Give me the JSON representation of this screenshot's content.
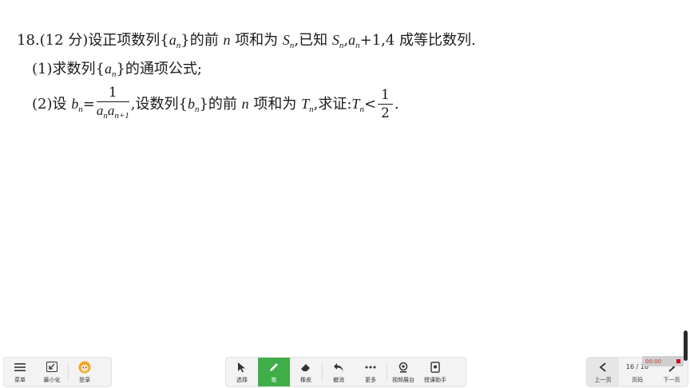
{
  "problem": {
    "intro": {
      "number": "18.",
      "score": "(12 分)",
      "text1": "设正项数列{",
      "seq": "a",
      "seq_sub": "n",
      "text2": "}的前",
      "n_var": "n",
      "text3": "项和为",
      "S": "S",
      "S_sub": "n",
      "text4": ",已知",
      "S2": "S",
      "S2_sub": "n",
      "comma": ",",
      "a": "a",
      "a_sub": "n",
      "text5": "+1,4 成等比数列."
    },
    "part1": {
      "label": "(1)",
      "text1": "求数列{",
      "a": "a",
      "a_sub": "n",
      "text2": "}的通项公式;"
    },
    "part2": {
      "label": "(2)",
      "text1": "设",
      "b": "b",
      "b_sub": "n",
      "eq": "=",
      "frac_num": "1",
      "frac_a1": "a",
      "frac_a1_sub": "n",
      "frac_a2": "a",
      "frac_a2_sub": "n+1",
      "text2": ",设数列{",
      "b2": "b",
      "b2_sub": "n",
      "text3": "}的前",
      "n_var": "n",
      "text4": "项和为",
      "T": "T",
      "T_sub": "n",
      "text5": ",求证:",
      "T2": "T",
      "T2_sub": "n",
      "lt": "<",
      "half_num": "1",
      "half_den": "2",
      "period": "."
    }
  },
  "left_toolbar": {
    "menu_label": "菜单",
    "minimize_label": "最小化",
    "login_label": "登录"
  },
  "center_toolbar": {
    "select_label": "选择",
    "pen_label": "笔",
    "eraser_label": "橡皮",
    "undo_label": "撤消",
    "more_label": "更多",
    "video_label": "视频展台",
    "assistant_label": "授课助手"
  },
  "right_toolbar": {
    "prev_label": "上一页",
    "page_indicator": "16 / 18",
    "page_label": "页码",
    "next_label": "下一页"
  },
  "recording": {
    "time": "00:00"
  },
  "colors": {
    "pen_active": "#3fae49",
    "toolbar_bg": "#f3f3f3",
    "record": "#d0021b"
  }
}
